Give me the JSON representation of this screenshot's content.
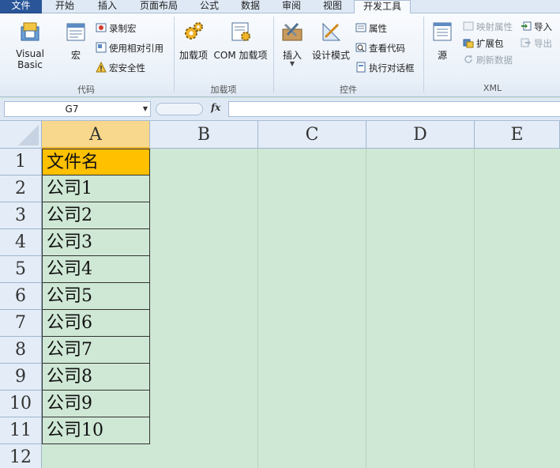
{
  "tabs": [
    {
      "label": "文件"
    },
    {
      "label": "开始"
    },
    {
      "label": "插入"
    },
    {
      "label": "页面布局"
    },
    {
      "label": "公式"
    },
    {
      "label": "数据"
    },
    {
      "label": "审阅"
    },
    {
      "label": "视图"
    },
    {
      "label": "开发工具"
    }
  ],
  "ribbon": {
    "code": {
      "visual_basic": "Visual Basic",
      "macros": "宏",
      "record_macro": "录制宏",
      "relative_ref": "使用相对引用",
      "macro_security": "宏安全性",
      "group_label": "代码"
    },
    "addins": {
      "addins": "加载项",
      "com_addins": "COM 加载项",
      "group_label": "加载项"
    },
    "controls": {
      "insert": "插入",
      "design_mode": "设计模式",
      "properties": "属性",
      "view_code": "查看代码",
      "run_dialog": "执行对话框",
      "group_label": "控件"
    },
    "xml": {
      "source": "源",
      "map_properties": "映射属性",
      "expansion_packs": "扩展包",
      "refresh_data": "刷新数据",
      "import": "导入",
      "export": "导出",
      "group_label": "XML"
    }
  },
  "formula_bar": {
    "name_box": "G7",
    "fx": "fx",
    "formula": ""
  },
  "sheet": {
    "columns": [
      "A",
      "B",
      "C",
      "D",
      "E"
    ],
    "rows": [
      "1",
      "2",
      "3",
      "4",
      "5",
      "6",
      "7",
      "8",
      "9",
      "10",
      "11",
      "12"
    ],
    "cells_a": [
      "文件名",
      "公司1",
      "公司2",
      "公司3",
      "公司4",
      "公司5",
      "公司6",
      "公司7",
      "公司8",
      "公司9",
      "公司10"
    ]
  },
  "colors": {
    "file_tab": "#2a5699",
    "header_cell": "#ffc000",
    "sheet_background": "#cfe8d5",
    "selected_column_header": "#f8d88c"
  }
}
